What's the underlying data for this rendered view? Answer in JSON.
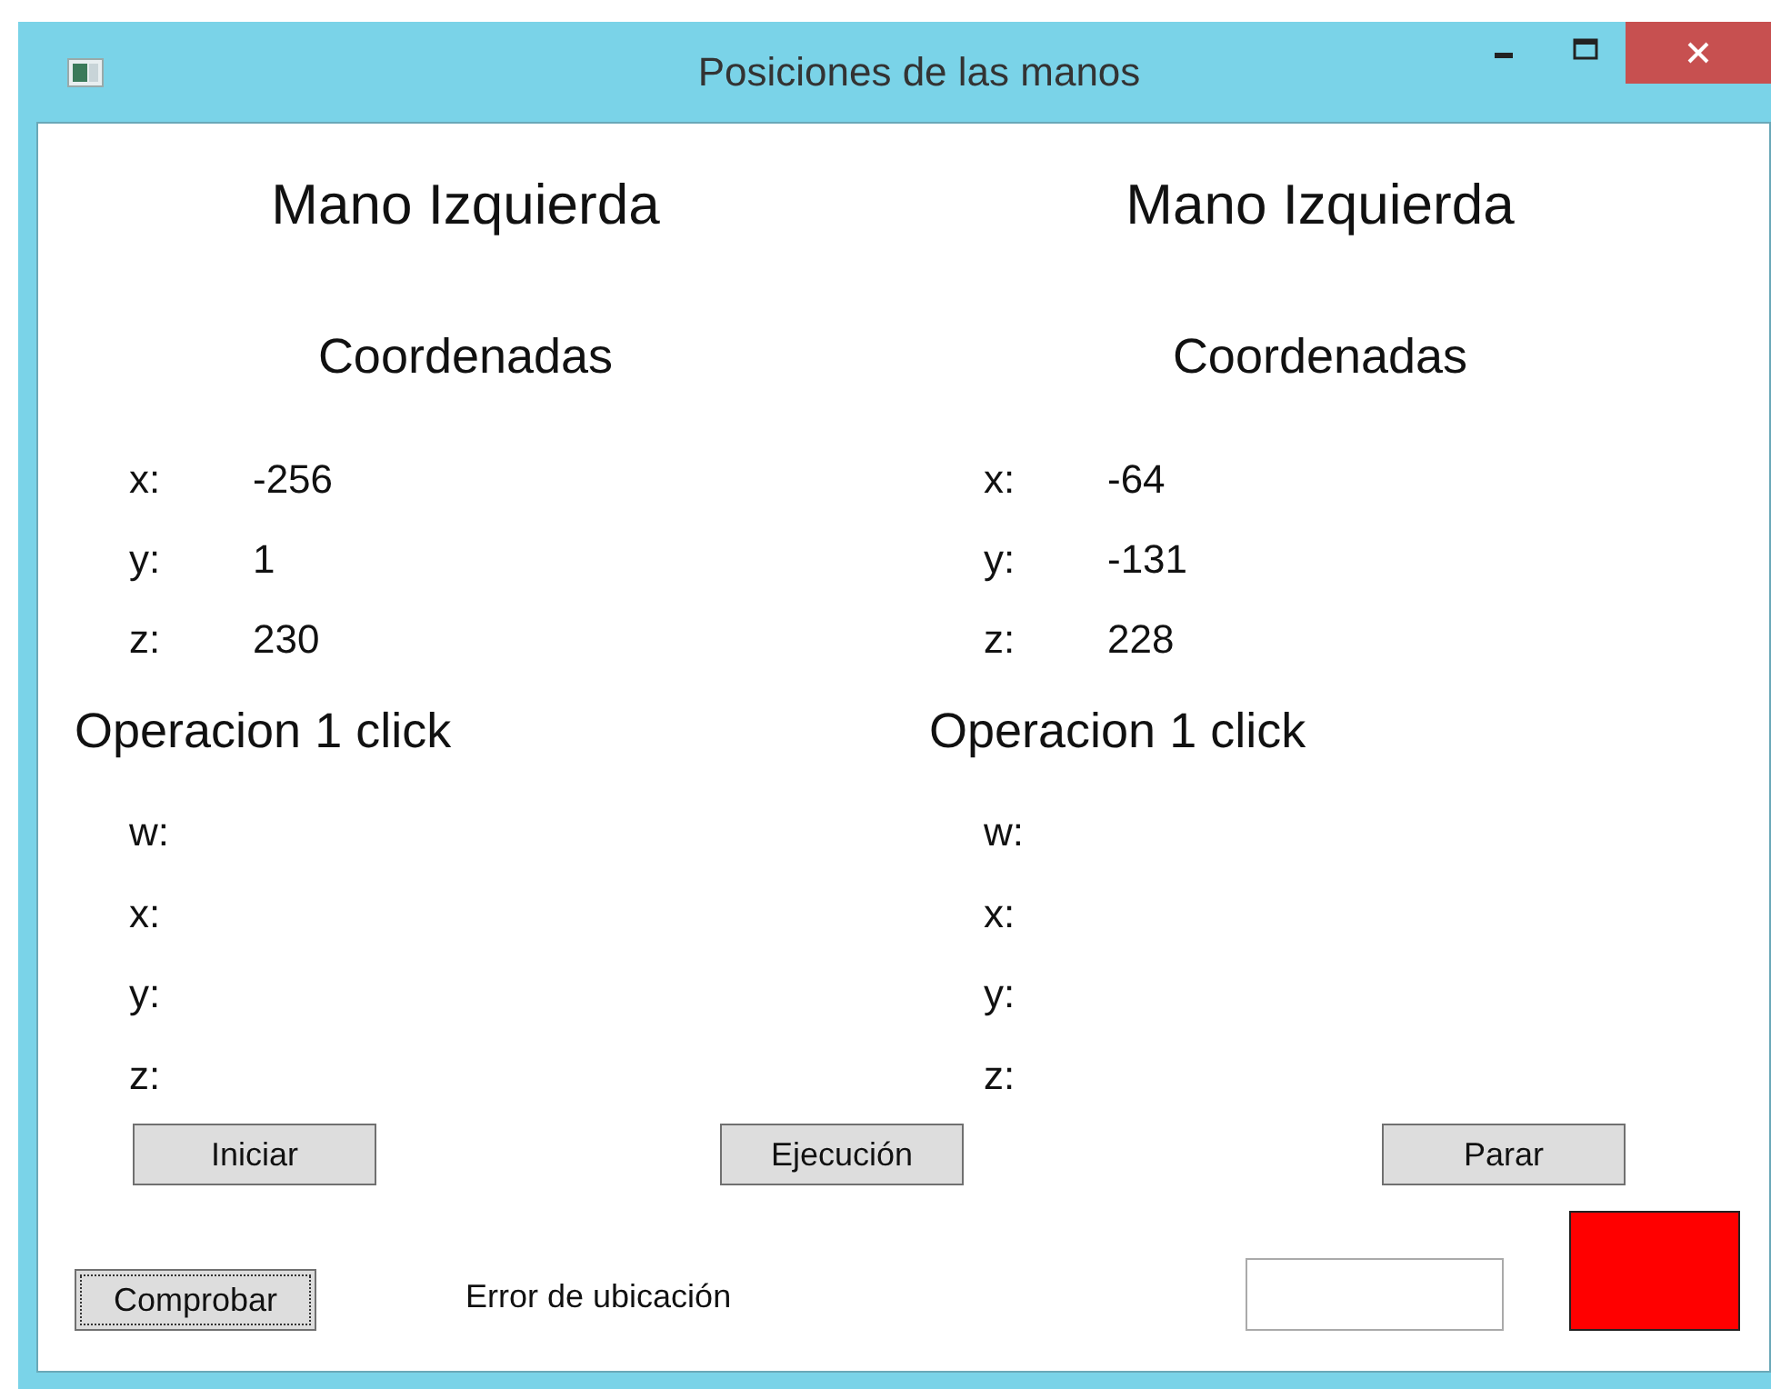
{
  "window": {
    "title": "Posiciones de las manos"
  },
  "hands": [
    {
      "heading": "Mano Izquierda",
      "subheading": "Coordenadas",
      "coordinates": [
        {
          "label": "x:",
          "value": "-256"
        },
        {
          "label": "y:",
          "value": "1"
        },
        {
          "label": "z:",
          "value": "230"
        }
      ],
      "operation_heading": "Operacion 1 click",
      "operation_fields": [
        {
          "label": "w:"
        },
        {
          "label": "x:"
        },
        {
          "label": "y:"
        },
        {
          "label": "z:"
        }
      ]
    },
    {
      "heading": "Mano Izquierda",
      "subheading": "Coordenadas",
      "coordinates": [
        {
          "label": "x:",
          "value": "-64"
        },
        {
          "label": "y:",
          "value": "-131"
        },
        {
          "label": "z:",
          "value": "228"
        }
      ],
      "operation_heading": "Operacion 1 click",
      "operation_fields": [
        {
          "label": "w:"
        },
        {
          "label": "x:"
        },
        {
          "label": "y:"
        },
        {
          "label": "z:"
        }
      ]
    }
  ],
  "buttons": [
    {
      "label": "Iniciar"
    },
    {
      "label": "Ejecución"
    },
    {
      "label": "Parar"
    }
  ],
  "check_button": {
    "label": "Comprobar",
    "focused": true
  },
  "error_label": "Error de ubicación",
  "indicator": {
    "color": "#ff0000"
  }
}
